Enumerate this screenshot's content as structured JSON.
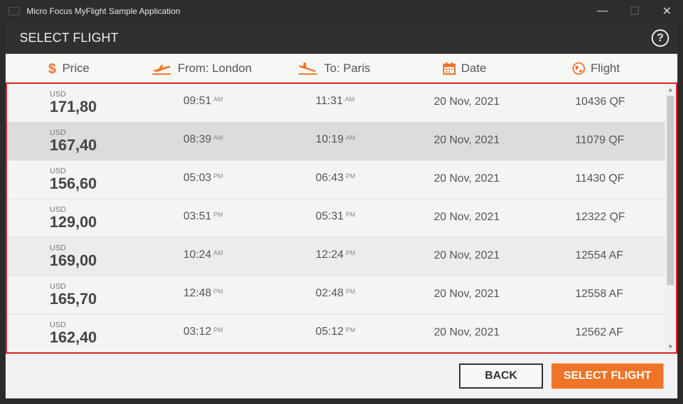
{
  "window": {
    "title": "Micro Focus MyFlight Sample Application",
    "controls": {
      "minimize": "—",
      "maximize": "☐",
      "close": "✕"
    }
  },
  "dialog": {
    "title": "SELECT FLIGHT",
    "help_label": "?"
  },
  "columns": {
    "price": "Price",
    "from": "From: London",
    "to": "To: Paris",
    "date": "Date",
    "flight": "Flight"
  },
  "accent_color": "#f07428",
  "flights": [
    {
      "currency": "USD",
      "price": "171,80",
      "dep_time": "09:51",
      "dep_ampm": "AM",
      "arr_time": "11:31",
      "arr_ampm": "AM",
      "date": "20 Nov, 2021",
      "flight": "10436 QF"
    },
    {
      "currency": "USD",
      "price": "167,40",
      "dep_time": "08:39",
      "dep_ampm": "AM",
      "arr_time": "10:19",
      "arr_ampm": "AM",
      "date": "20 Nov, 2021",
      "flight": "11079 QF"
    },
    {
      "currency": "USD",
      "price": "156,60",
      "dep_time": "05:03",
      "dep_ampm": "PM",
      "arr_time": "06:43",
      "arr_ampm": "PM",
      "date": "20 Nov, 2021",
      "flight": "11430 QF"
    },
    {
      "currency": "USD",
      "price": "129,00",
      "dep_time": "03:51",
      "dep_ampm": "PM",
      "arr_time": "05:31",
      "arr_ampm": "PM",
      "date": "20 Nov, 2021",
      "flight": "12322 QF"
    },
    {
      "currency": "USD",
      "price": "169,00",
      "dep_time": "10:24",
      "dep_ampm": "AM",
      "arr_time": "12:24",
      "arr_ampm": "PM",
      "date": "20 Nov, 2021",
      "flight": "12554 AF"
    },
    {
      "currency": "USD",
      "price": "165,70",
      "dep_time": "12:48",
      "dep_ampm": "PM",
      "arr_time": "02:48",
      "arr_ampm": "PM",
      "date": "20 Nov, 2021",
      "flight": "12558 AF"
    },
    {
      "currency": "USD",
      "price": "162,40",
      "dep_time": "03:12",
      "dep_ampm": "PM",
      "arr_time": "05:12",
      "arr_ampm": "PM",
      "date": "20 Nov, 2021",
      "flight": "12562 AF"
    }
  ],
  "buttons": {
    "back": "BACK",
    "select": "SELECT FLIGHT"
  }
}
